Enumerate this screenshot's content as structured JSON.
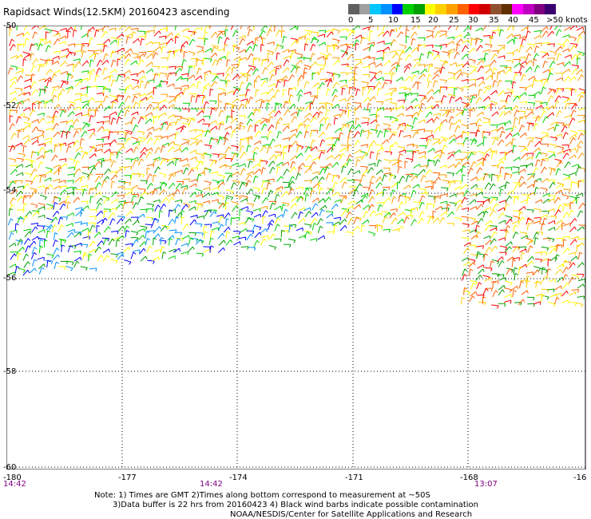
{
  "title": "Rapidsact Winds(12.5KM) 20160423 ascending",
  "legend": {
    "colors": [
      "#606060",
      "#a0a0a0",
      "#00c8ff",
      "#0090ff",
      "#0000ff",
      "#00d000",
      "#00a000",
      "#ffff00",
      "#ffd000",
      "#ffa000",
      "#ff6000",
      "#ff0000",
      "#d00000",
      "#905030",
      "#603000",
      "#ff00ff",
      "#c000c0",
      "#800080",
      "#3a0070"
    ],
    "ticks": [
      "0",
      "5",
      "10",
      "15",
      "20",
      "25",
      "30",
      "35",
      "40",
      "45",
      ">50 knots"
    ]
  },
  "lat_labels": [
    "-50",
    "-52",
    "-54",
    "-56",
    "-58",
    "-60"
  ],
  "lon_labels": [
    "-180",
    "-177",
    "-174",
    "-171",
    "-168",
    "-16"
  ],
  "time_labels": [
    "14:42",
    "14:42",
    "13:07"
  ],
  "notes": [
    "Note: 1) Times are GMT 2)Times along bottom correspond to measurement at ~50S",
    "3)Data buffer is 22 hrs from 20160423 4) Black wind barbs indicate possible contamination",
    "NOAA/NESDIS/Center for Satellite Applications and Research"
  ]
}
